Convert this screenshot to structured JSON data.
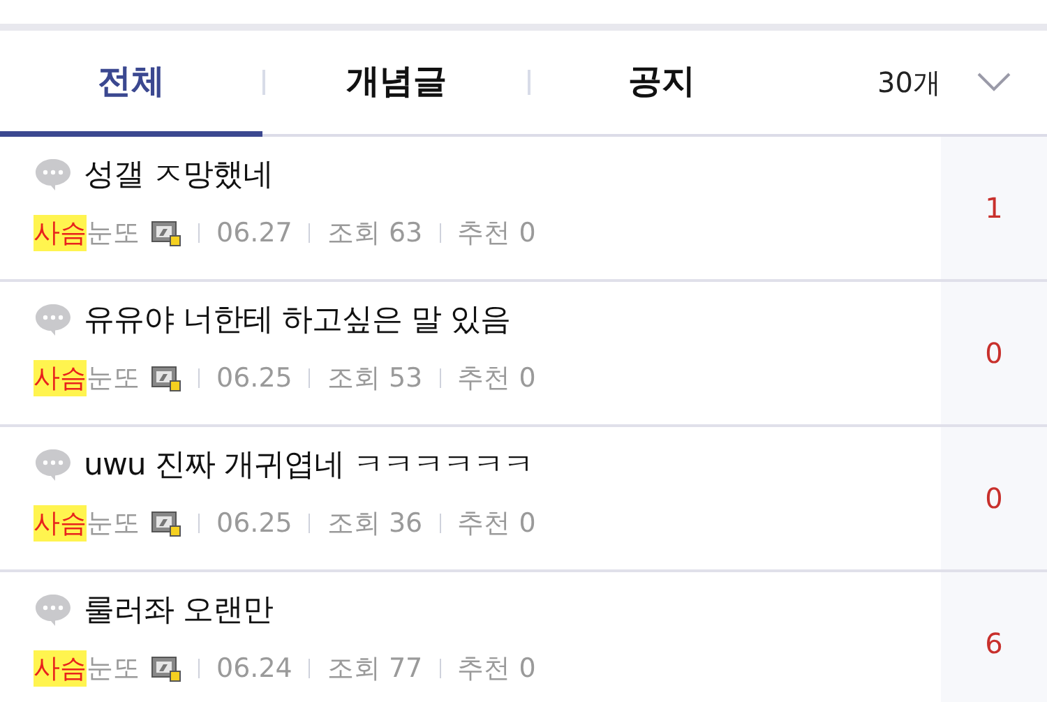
{
  "tabs": [
    {
      "label": "전체",
      "selected": true
    },
    {
      "label": "개념글",
      "selected": false
    },
    {
      "label": "공지",
      "selected": false
    }
  ],
  "post_count": "30개",
  "posts": [
    {
      "title": "성갤 ㅈ망했네",
      "author_highlight": "사슴",
      "author_rest": "눈또",
      "date": "06.27",
      "views_label": "조회",
      "views": "63",
      "recommend_label": "추천",
      "recommend": "0",
      "comments": "1"
    },
    {
      "title": "유유야 너한테 하고싶은 말 있음",
      "author_highlight": "사슴",
      "author_rest": "눈또",
      "date": "06.25",
      "views_label": "조회",
      "views": "53",
      "recommend_label": "추천",
      "recommend": "0",
      "comments": "0"
    },
    {
      "title": "uwu 진짜 개귀엽네 ㅋㅋㅋㅋㅋㅋ",
      "author_highlight": "사슴",
      "author_rest": "눈또",
      "date": "06.25",
      "views_label": "조회",
      "views": "36",
      "recommend_label": "추천",
      "recommend": "0",
      "comments": "0"
    },
    {
      "title": "룰러좌 오랜만",
      "author_highlight": "사슴",
      "author_rest": "눈또",
      "date": "06.24",
      "views_label": "조회",
      "views": "77",
      "recommend_label": "추천",
      "recommend": "0",
      "comments": "6"
    }
  ]
}
